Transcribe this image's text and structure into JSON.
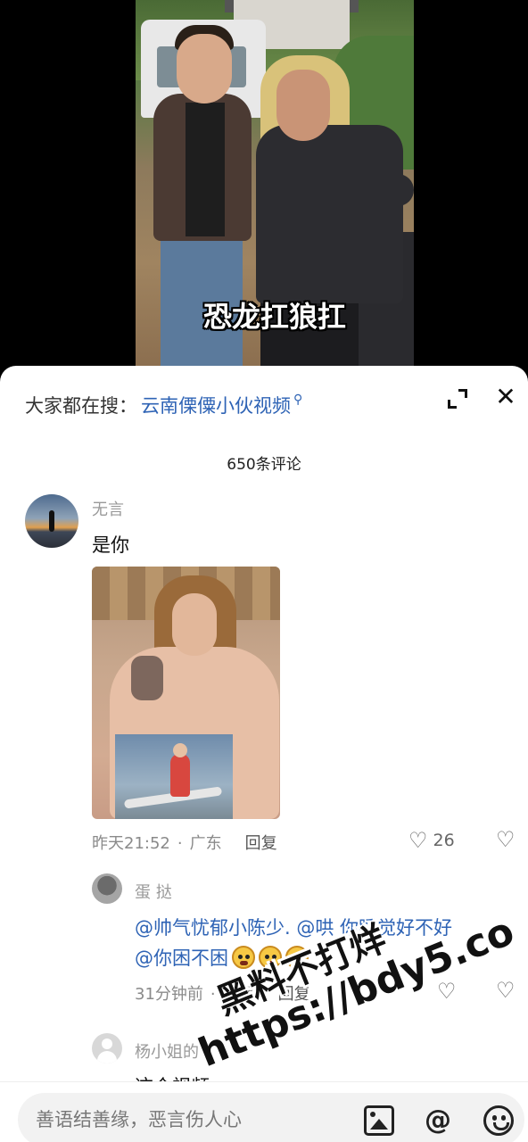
{
  "video": {
    "caption": "恐龙扛狼扛"
  },
  "search_bar": {
    "prefix": "大家都在搜：",
    "keyword": "云南傈僳小伙视频",
    "icon": "search-icon"
  },
  "header": {
    "expand_icon": "expand-icon",
    "close_label": "✕"
  },
  "comment_count": "650条评论",
  "comments": [
    {
      "username": "无言",
      "text": "是你",
      "has_image": true,
      "time": "昨天21:52",
      "location": "广东",
      "reply_label": "回复",
      "likes": "26"
    }
  ],
  "replies": [
    {
      "username": "蛋 挞",
      "text_line1": "@帅气忧郁小陈少. @哄 你睡觉好不好",
      "text_line2": "@你困不困",
      "emoji_count": 3,
      "time": "31分钟前",
      "location": "广西",
      "reply_label": "回复"
    },
    {
      "username": "杨小姐的",
      "text_partial": "这个视频"
    }
  ],
  "input": {
    "placeholder": "善语结善缘，恶言伤人心",
    "icons": [
      "image-icon",
      "at-icon",
      "emoji-icon"
    ],
    "at_label": "@"
  },
  "meta_separator": "·",
  "watermark": {
    "line1": "黑料不打烊",
    "line2": "https://bdy5.co"
  }
}
